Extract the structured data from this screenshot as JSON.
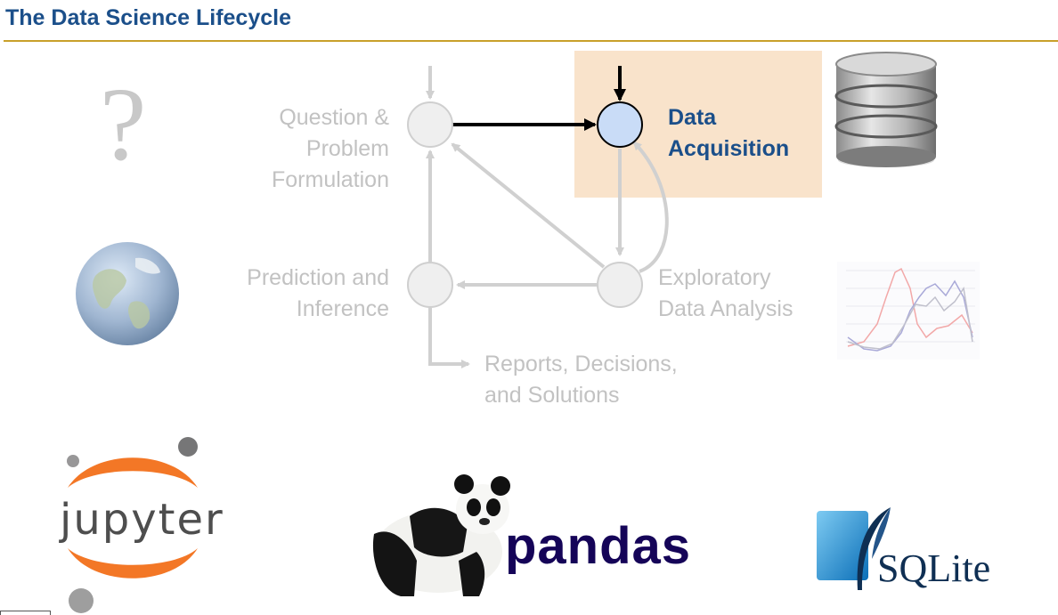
{
  "slide": {
    "title": "The Data Science Lifecycle"
  },
  "stages": {
    "question": {
      "line1": "Question &",
      "line2": "Problem",
      "line3": "Formulation"
    },
    "acquisition": {
      "line1": "Data",
      "line2": "Acquisition"
    },
    "prediction": {
      "line1": "Prediction and",
      "line2": "Inference"
    },
    "eda": {
      "line1": "Exploratory",
      "line2": "Data Analysis"
    },
    "reports": {
      "line1": "Reports, Decisions,",
      "line2": "and Solutions"
    }
  },
  "logos": {
    "jupyter": "jupyter",
    "pandas": "pandas",
    "sqlite": "SQLite"
  },
  "icons": {
    "question_mark": "?"
  },
  "colors": {
    "title": "#1b4f8a",
    "rule": "#c8a02a",
    "highlight": "#f9e3cb",
    "active_node": "#c9dcf7",
    "inactive": "#c2c2c2",
    "jupyter_orange": "#f37726",
    "pandas_navy": "#150458",
    "sqlite_blue": "#0f80cc"
  }
}
